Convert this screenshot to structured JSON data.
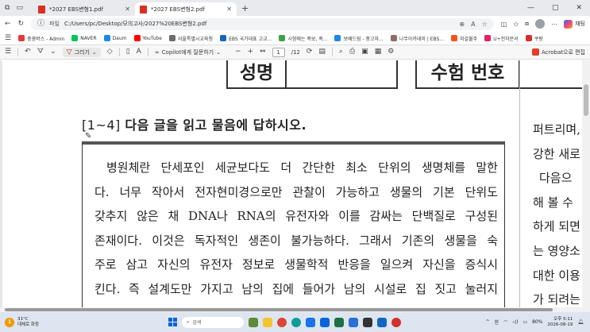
{
  "browser": {
    "tabs": [
      {
        "label": "*2027 EBS변형1.pdf",
        "active": false
      },
      {
        "label": "*2027 EBS변형2.pdf",
        "active": true
      }
    ],
    "address": {
      "chip": "파일",
      "url": "C:/Users/pc/Desktop/모의고사/2027%20EBS변형2.pdf"
    },
    "copilot_label": "채팅",
    "bookmarks": [
      {
        "label": "충광버스 - Admin",
        "color": "#e53935"
      },
      {
        "label": "NAVER",
        "color": "#03c75a"
      },
      {
        "label": "Daum",
        "color": "#1e88e5"
      },
      {
        "label": "YouTube",
        "color": "#ff0000"
      },
      {
        "label": "서울특별시교육청",
        "color": "#6d6d6d"
      },
      {
        "label": "EBS 국가대표 고교...",
        "color": "#1565c0"
      },
      {
        "label": "시험에는 족보, 족...",
        "color": "#43a047"
      },
      {
        "label": "보배드림 - 중고자...",
        "color": "#1e88e5"
      },
      {
        "label": "나무아카데미 | EBS...",
        "color": "#8d6e63"
      },
      {
        "label": "미갈불주",
        "color": "#f4511e"
      },
      {
        "label": "U+전자문서",
        "color": "#e91e63"
      },
      {
        "label": "쿠팡",
        "color": "#d32f2f"
      }
    ]
  },
  "pdf_toolbar": {
    "draw_label": "그리기",
    "copilot_ask": "Copilot에게 질문하기",
    "current_page": "1",
    "total_pages": "/12",
    "acrobat_label": "Acrobat으로 편집"
  },
  "document": {
    "header_name_label": "성명",
    "header_exam_label": "수험 번호",
    "question_range": "[1~4]",
    "question_text": "다음 글을 읽고 물음에 답하시오.",
    "passage_lines": [
      "병원체란 단세포인 세균보다도 더 간단한 최소 단위의 생명체를 말한",
      "다. 너무 작아서 전자현미경으로만 관찰이 가능하고 생물의 기본 단위도",
      "갖추지 않은 채 DNA나 RNA의 유전자와 이를 감싸는 단백질로 구성된",
      "존재이다. 이것은 독자적인 생존이 불가능하다. 그래서 기존의 생물을 숙",
      "주로 삼고 자신의 유전자 정보로 생물학적 반응을 일으켜 자신을 증식시",
      "킨다. 즉 설계도만 가지고 남의 집에 들어가 남의 시설로 집 짓고 눌러지"
    ],
    "right_column_lines": [
      "퍼트리며,",
      "강한 새로",
      "다음으",
      "해 볼 수",
      "하게 되면",
      "는 영양소",
      "대한 이용",
      "가 되려는"
    ]
  },
  "taskbar": {
    "weather_temp": "31°C",
    "weather_desc": "대체로 화창",
    "weather_badge": "1",
    "search_label": "검색",
    "tray_ime": "한",
    "battery": "80%",
    "time": "오후 5:11",
    "date": "2026-08-19"
  }
}
